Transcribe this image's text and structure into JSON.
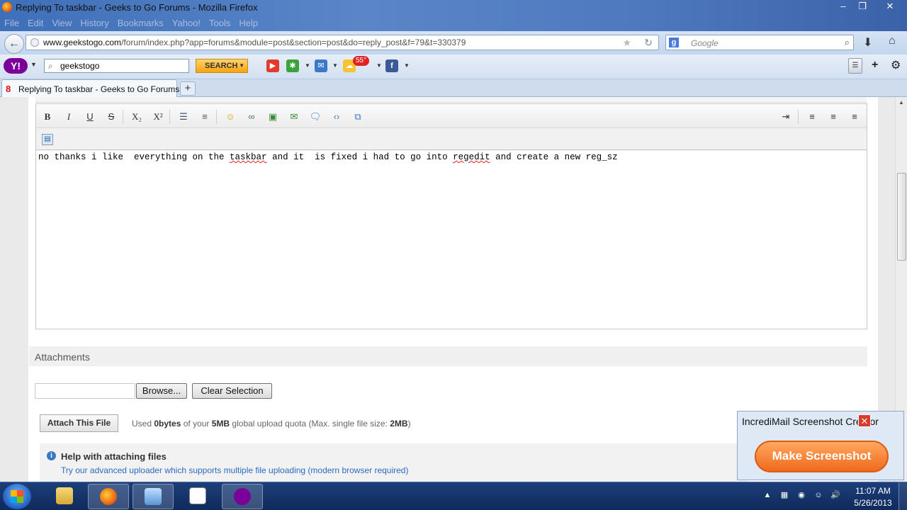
{
  "window": {
    "title": "Replying To taskbar - Geeks to Go Forums - Mozilla Firefox",
    "min_icon": "minimize-icon",
    "max_icon": "maximize-icon",
    "close_icon": "close-icon"
  },
  "menubar": [
    "File",
    "Edit",
    "View",
    "History",
    "Bookmarks",
    "Yahoo!",
    "Tools",
    "Help"
  ],
  "navbar": {
    "url_domain": "www.geekstogo.com",
    "url_path": "/forum/index.php?app=forums&module=post&section=post&do=reply_post&f=79&t=330379",
    "search_placeholder": "Google"
  },
  "yahoo_toolbar": {
    "logo": "Y!",
    "search_value": "geekstogo",
    "search_button": "SEARCH",
    "weather_badge": "55°"
  },
  "tabs": [
    {
      "label": "Replying To taskbar - Geeks to Go Forums",
      "active": true
    }
  ],
  "editor": {
    "toolbar": {
      "bold": "B",
      "italic": "I",
      "underline": "U",
      "strike": "S",
      "subscript": "X₂",
      "superscript": "X²"
    },
    "text_before_1": "no thanks i like  everything on the ",
    "misspelled_1": "taskbar",
    "text_between": " and it  is fixed i had to go into ",
    "misspelled_2": "regedit",
    "text_after": " and create a new reg_sz"
  },
  "attachments": {
    "heading": "Attachments",
    "browse_button": "Browse...",
    "clear_button": "Clear Selection",
    "attach_button": "Attach This File",
    "quota_prefix": "Used ",
    "quota_used": "0bytes",
    "quota_mid": " of your ",
    "quota_total": "5MB",
    "quota_mid2": " global upload quota (Max. single file size: ",
    "quota_max": "2MB",
    "quota_suffix": ")",
    "help_title": "Help with attaching files",
    "help_link": "Try our advanced uploader which supports multiple file uploading (modern browser required)"
  },
  "popup": {
    "title": "IncrediMail Screenshot Creator",
    "button": "Make Screenshot"
  },
  "taskbar": {
    "time": "11:07 AM",
    "date": "5/26/2013"
  },
  "colors": {
    "accent_link": "#2a6bc4",
    "spell_error": "#d22222",
    "popup_button": "#ef6a1c",
    "taskbar": "#1d3f7a"
  }
}
